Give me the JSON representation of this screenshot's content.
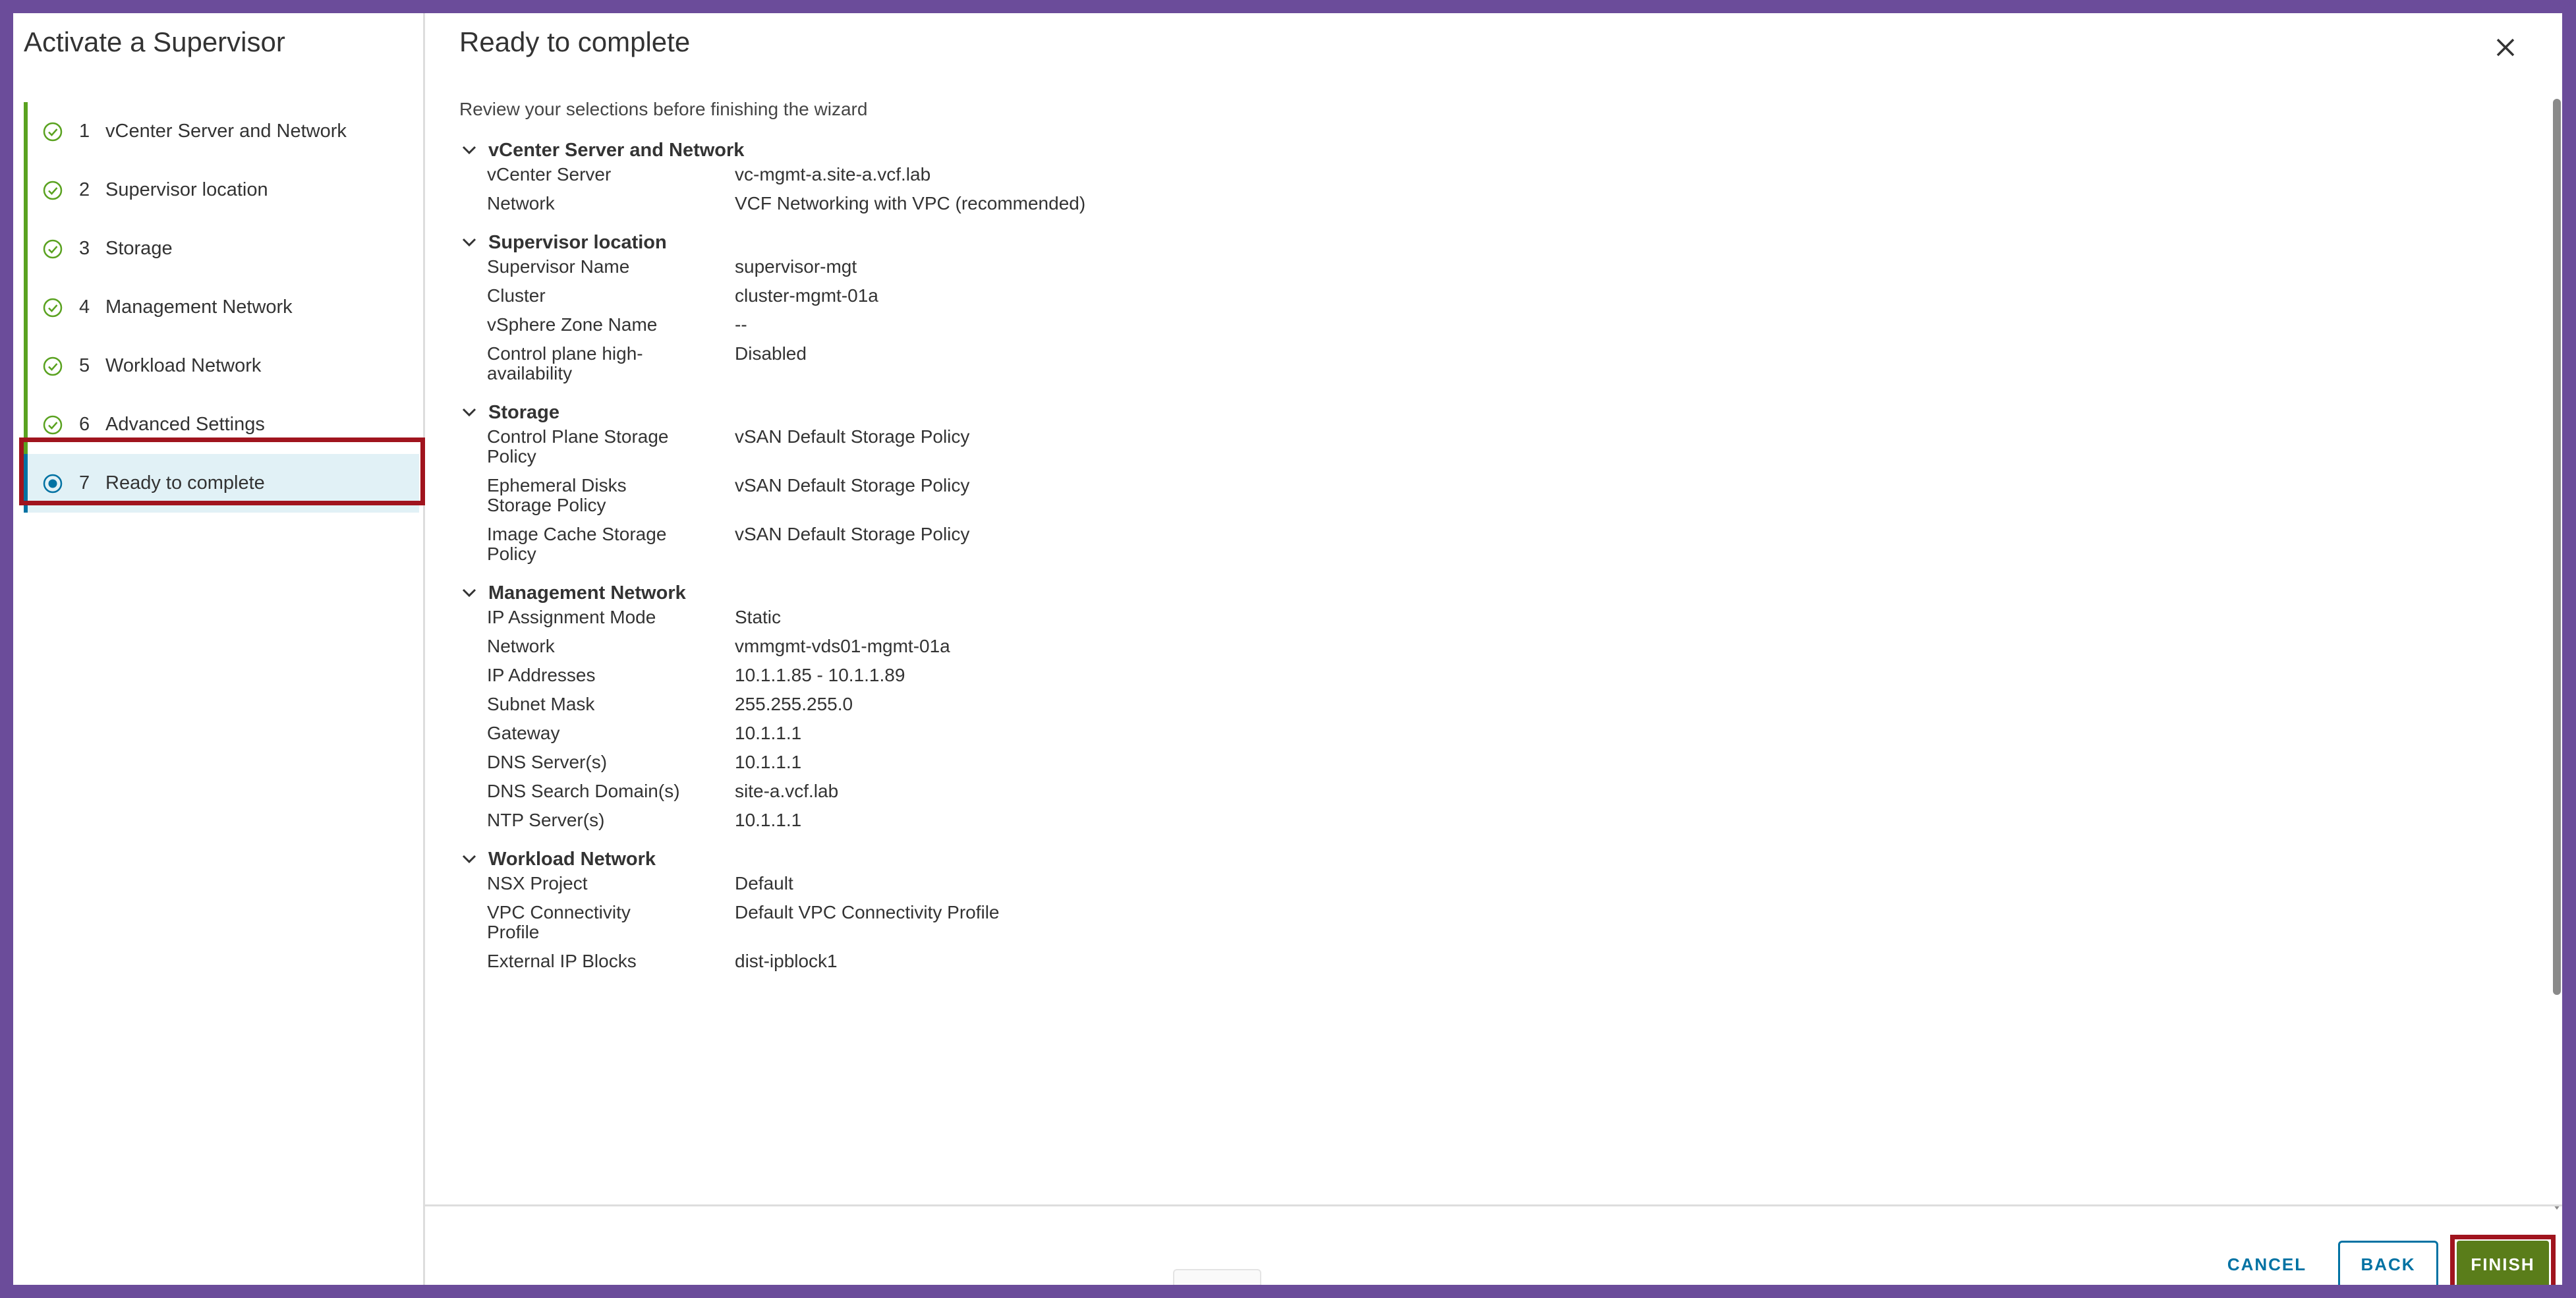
{
  "nav": {
    "title": "Activate a Supervisor",
    "steps": [
      {
        "num": "1",
        "label": "vCenter Server and Network",
        "status": "complete"
      },
      {
        "num": "2",
        "label": "Supervisor location",
        "status": "complete"
      },
      {
        "num": "3",
        "label": "Storage",
        "status": "complete"
      },
      {
        "num": "4",
        "label": "Management Network",
        "status": "complete"
      },
      {
        "num": "5",
        "label": "Workload Network",
        "status": "complete"
      },
      {
        "num": "6",
        "label": "Advanced Settings",
        "status": "complete"
      },
      {
        "num": "7",
        "label": "Ready to complete",
        "status": "current"
      }
    ]
  },
  "main": {
    "title": "Ready to complete",
    "subtitle": "Review your selections before finishing the wizard",
    "sections": [
      {
        "title": "vCenter Server and Network",
        "rows": [
          {
            "label": "vCenter Server",
            "value": "vc-mgmt-a.site-a.vcf.lab"
          },
          {
            "label": "Network",
            "value": "VCF Networking with VPC (recommended)"
          }
        ]
      },
      {
        "title": "Supervisor location",
        "rows": [
          {
            "label": "Supervisor Name",
            "value": "supervisor-mgt"
          },
          {
            "label": "Cluster",
            "value": "cluster-mgmt-01a"
          },
          {
            "label": "vSphere Zone Name",
            "value": "--"
          },
          {
            "label": "Control plane high-availability",
            "value": "Disabled"
          }
        ]
      },
      {
        "title": "Storage",
        "rows": [
          {
            "label": "Control Plane Storage Policy",
            "value": "vSAN Default Storage Policy"
          },
          {
            "label": "Ephemeral Disks Storage Policy",
            "value": "vSAN Default Storage Policy"
          },
          {
            "label": "Image Cache Storage Policy",
            "value": "vSAN Default Storage Policy"
          }
        ]
      },
      {
        "title": "Management Network",
        "rows": [
          {
            "label": "IP Assignment Mode",
            "value": "Static"
          },
          {
            "label": "Network",
            "value": "vmmgmt-vds01-mgmt-01a"
          },
          {
            "label": "IP Addresses",
            "value": "10.1.1.85 - 10.1.1.89"
          },
          {
            "label": "Subnet Mask",
            "value": "255.255.255.0"
          },
          {
            "label": "Gateway",
            "value": "10.1.1.1"
          },
          {
            "label": "DNS Server(s)",
            "value": "10.1.1.1"
          },
          {
            "label": "DNS Search Domain(s)",
            "value": "site-a.vcf.lab"
          },
          {
            "label": "NTP Server(s)",
            "value": "10.1.1.1"
          }
        ]
      },
      {
        "title": "Workload Network",
        "rows": [
          {
            "label": "NSX Project",
            "value": "Default"
          },
          {
            "label": "VPC Connectivity Profile",
            "value": "Default VPC Connectivity Profile"
          },
          {
            "label": "External IP Blocks",
            "value": "dist-ipblock1"
          }
        ]
      }
    ]
  },
  "footer": {
    "cancel_label": "CANCEL",
    "back_label": "BACK",
    "finish_label": "FINISH"
  },
  "colors": {
    "frame_purple": "#6b4c9a",
    "complete_green": "#5aa220",
    "current_blue": "#0072a3",
    "current_bg": "#e1f1f6",
    "finish_green": "#5a7d1a",
    "highlight_red": "#a0141e"
  }
}
